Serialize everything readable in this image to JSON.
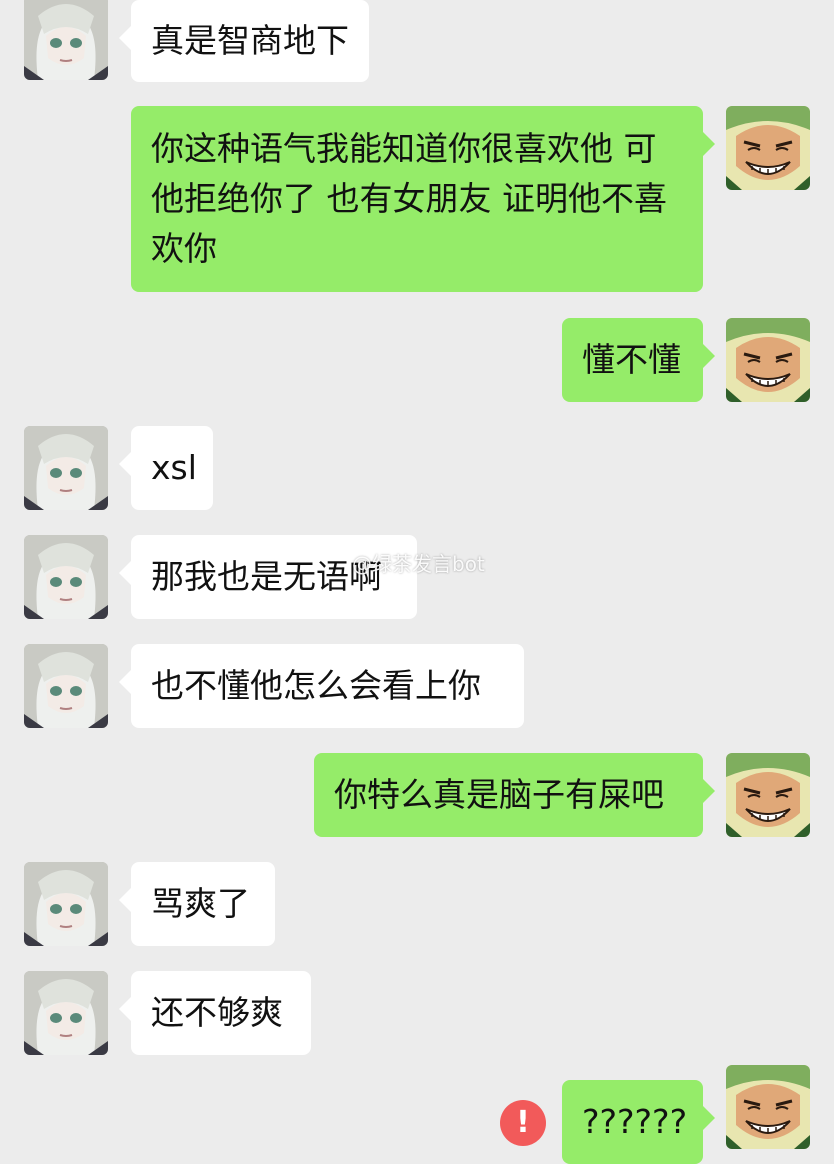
{
  "messages": [
    {
      "side": "left",
      "text": "真是智商地下"
    },
    {
      "side": "right",
      "text": "你这种语气我能知道你很喜欢他 可他拒绝你了 也有女朋友 证明他不喜欢你"
    },
    {
      "side": "right",
      "text": "懂不懂"
    },
    {
      "side": "left",
      "text": "xsl"
    },
    {
      "side": "left",
      "text": "那我也是无语啊"
    },
    {
      "side": "left",
      "text": "也不懂他怎么会看上你"
    },
    {
      "side": "right",
      "text": "你特么真是脑子有屎吧"
    },
    {
      "side": "left",
      "text": "骂爽了"
    },
    {
      "side": "left",
      "text": "还不够爽"
    },
    {
      "side": "right",
      "text": "??????",
      "failed": true
    }
  ],
  "error_badge": "!",
  "watermark": "@绿茶发言bot",
  "colors": {
    "background": "#ececec",
    "left_bubble": "#ffffff",
    "right_bubble": "#95ec69",
    "error": "#f25a5a"
  },
  "icons": {
    "left_avatar": "anime-girl-avatar-icon",
    "right_avatar": "grinning-man-avatar-icon",
    "error": "error-icon",
    "watermark_logo": "weibo-icon"
  }
}
